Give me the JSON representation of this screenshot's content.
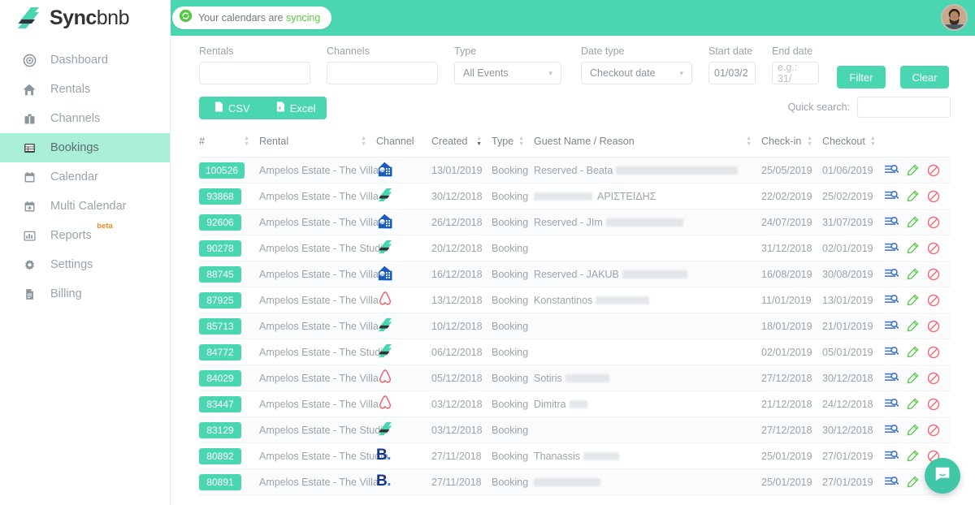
{
  "brand": {
    "name_bold": "Sync",
    "name_light": "bnb",
    "logo_icon": "syncbnb-logo-mark"
  },
  "topbar": {
    "sync_badge": {
      "icon": "sync-refresh-icon",
      "text_prefix": "Your calendars are ",
      "text_highlight": "syncing"
    },
    "avatar": "user-avatar"
  },
  "sidebar": {
    "items": [
      {
        "label": "Dashboard",
        "icon": "dashboard-target-icon",
        "active": false
      },
      {
        "label": "Rentals",
        "icon": "house-icon",
        "active": false
      },
      {
        "label": "Channels",
        "icon": "briefcase-icon",
        "active": false
      },
      {
        "label": "Bookings",
        "icon": "table-list-icon",
        "active": true
      },
      {
        "label": "Calendar",
        "icon": "calendar-icon",
        "active": false
      },
      {
        "label": "Multi Calendar",
        "icon": "calendar-plus-icon",
        "active": false
      },
      {
        "label": "Reports",
        "icon": "bar-chart-icon",
        "active": false,
        "badge": "beta"
      },
      {
        "label": "Settings",
        "icon": "gear-icon",
        "active": false
      },
      {
        "label": "Billing",
        "icon": "document-icon",
        "active": false
      }
    ]
  },
  "filters": {
    "rentals": {
      "label": "Rentals",
      "value": "",
      "placeholder": ""
    },
    "channels": {
      "label": "Channels",
      "value": "",
      "placeholder": ""
    },
    "type": {
      "label": "Type",
      "value": "All Events"
    },
    "date_type": {
      "label": "Date type",
      "value": "Checkout date"
    },
    "start_date": {
      "label": "Start date",
      "value": "01/03/2",
      "placeholder": ""
    },
    "end_date": {
      "label": "End date",
      "value": "",
      "placeholder": "e.g.: 31/"
    },
    "filter_button": "Filter",
    "clear_button": "Clear"
  },
  "toolbar": {
    "csv_label": "CSV",
    "excel_label": "Excel",
    "csv_icon": "file-csv-icon",
    "excel_icon": "file-excel-icon",
    "quick_search_label": "Quick search:",
    "quick_search_value": "",
    "quick_search_placeholder": ""
  },
  "table": {
    "columns": [
      {
        "label": "#",
        "sortable": true,
        "sort": "none"
      },
      {
        "label": "Rental",
        "sortable": true,
        "sort": "none"
      },
      {
        "label": "Channel",
        "sortable": false,
        "sort": "none"
      },
      {
        "label": "Created",
        "sortable": true,
        "sort": "desc"
      },
      {
        "label": "Type",
        "sortable": true,
        "sort": "none"
      },
      {
        "label": "Guest Name / Reason",
        "sortable": true,
        "sort": "none"
      },
      {
        "label": "Check-in",
        "sortable": true,
        "sort": "none"
      },
      {
        "label": "Checkout",
        "sortable": true,
        "sort": "none"
      },
      {
        "label": "",
        "sortable": false,
        "sort": "none"
      }
    ],
    "actions": {
      "details_icon": "details-search-icon",
      "edit_icon": "edit-pencil-icon",
      "cancel_icon": "cancel-prohibited-icon"
    },
    "rows": [
      {
        "id": "100526",
        "rental": "Ampelos Estate - The Villa",
        "channel": "homeaway",
        "created": "13/01/2019",
        "type": "Booking",
        "guest": "Reserved - Beata",
        "guest_redacted": 150,
        "checkin": "25/05/2019",
        "checkout": "01/06/2019"
      },
      {
        "id": "93868",
        "rental": "Ampelos Estate - The Villa",
        "channel": "syncbnb",
        "created": "30/12/2018",
        "type": "Booking",
        "guest": "",
        "guest_redacted_lead": 72,
        "guest_suffix": "ΑΡΙΣΤΕΙΔΗΣ",
        "checkin": "22/02/2019",
        "checkout": "25/02/2019"
      },
      {
        "id": "92606",
        "rental": "Ampelos Estate - The Villa",
        "channel": "homeaway",
        "created": "26/12/2018",
        "type": "Booking",
        "guest": "Reserved - JIm",
        "guest_redacted": 95,
        "checkin": "24/07/2019",
        "checkout": "31/07/2019"
      },
      {
        "id": "90278",
        "rental": "Ampelos Estate - The Studio",
        "channel": "syncbnb",
        "created": "20/12/2018",
        "type": "Booking",
        "guest": "",
        "checkin": "31/12/2018",
        "checkout": "02/01/2019"
      },
      {
        "id": "88745",
        "rental": "Ampelos Estate - The Villa",
        "channel": "homeaway",
        "created": "16/12/2018",
        "type": "Booking",
        "guest": "Reserved - JAKUB",
        "guest_redacted": 80,
        "checkin": "16/08/2019",
        "checkout": "30/08/2019"
      },
      {
        "id": "87925",
        "rental": "Ampelos Estate - The Villa",
        "channel": "airbnb",
        "created": "13/12/2018",
        "type": "Booking",
        "guest": "Konstantinos",
        "guest_redacted": 66,
        "checkin": "11/01/2019",
        "checkout": "13/01/2019"
      },
      {
        "id": "85713",
        "rental": "Ampelos Estate - The Villa",
        "channel": "syncbnb",
        "created": "10/12/2018",
        "type": "Booking",
        "guest": "",
        "checkin": "18/01/2019",
        "checkout": "21/01/2019"
      },
      {
        "id": "84772",
        "rental": "Ampelos Estate - The Studio",
        "channel": "syncbnb",
        "created": "06/12/2018",
        "type": "Booking",
        "guest": "",
        "checkin": "02/01/2019",
        "checkout": "05/01/2019"
      },
      {
        "id": "84029",
        "rental": "Ampelos Estate - The Villa",
        "channel": "airbnb",
        "created": "05/12/2018",
        "type": "Booking",
        "guest": "Sotiris",
        "guest_redacted": 54,
        "checkin": "27/12/2018",
        "checkout": "30/12/2018"
      },
      {
        "id": "83447",
        "rental": "Ampelos Estate - The Villa",
        "channel": "airbnb",
        "created": "03/12/2018",
        "type": "Booking",
        "guest": "Dimitra",
        "guest_redacted": 22,
        "checkin": "21/12/2018",
        "checkout": "24/12/2018"
      },
      {
        "id": "83129",
        "rental": "Ampelos Estate - The Studio",
        "channel": "syncbnb",
        "created": "03/12/2018",
        "type": "Booking",
        "guest": "",
        "checkin": "27/12/2018",
        "checkout": "30/12/2018"
      },
      {
        "id": "80892",
        "rental": "Ampelos Estate - The Studio",
        "channel": "booking",
        "created": "27/11/2018",
        "type": "Booking",
        "guest": "Thanassis",
        "guest_redacted": 44,
        "checkin": "25/01/2019",
        "checkout": "27/01/2019"
      },
      {
        "id": "80891",
        "rental": "Ampelos Estate - The Villa",
        "channel": "booking",
        "created": "27/11/2018",
        "type": "Booking",
        "guest": "",
        "guest_redacted_lead": 82,
        "checkin": "25/01/2019",
        "checkout": "27/01/2019"
      }
    ]
  },
  "intercom": {
    "icon": "intercom-chat-icon"
  },
  "colors": {
    "accent": "#4ad6b0",
    "topbar": "#4ad6b0",
    "active_nav": "#a9eed6",
    "sync_highlight": "#57c846",
    "beta_badge": "#f08a24",
    "airbnb": "#f25767",
    "booking": "#16368a",
    "homeaway": "#1c5bbd",
    "edit": "#57c846",
    "cancel": "#f56b72",
    "details": "#3f6fd0"
  }
}
